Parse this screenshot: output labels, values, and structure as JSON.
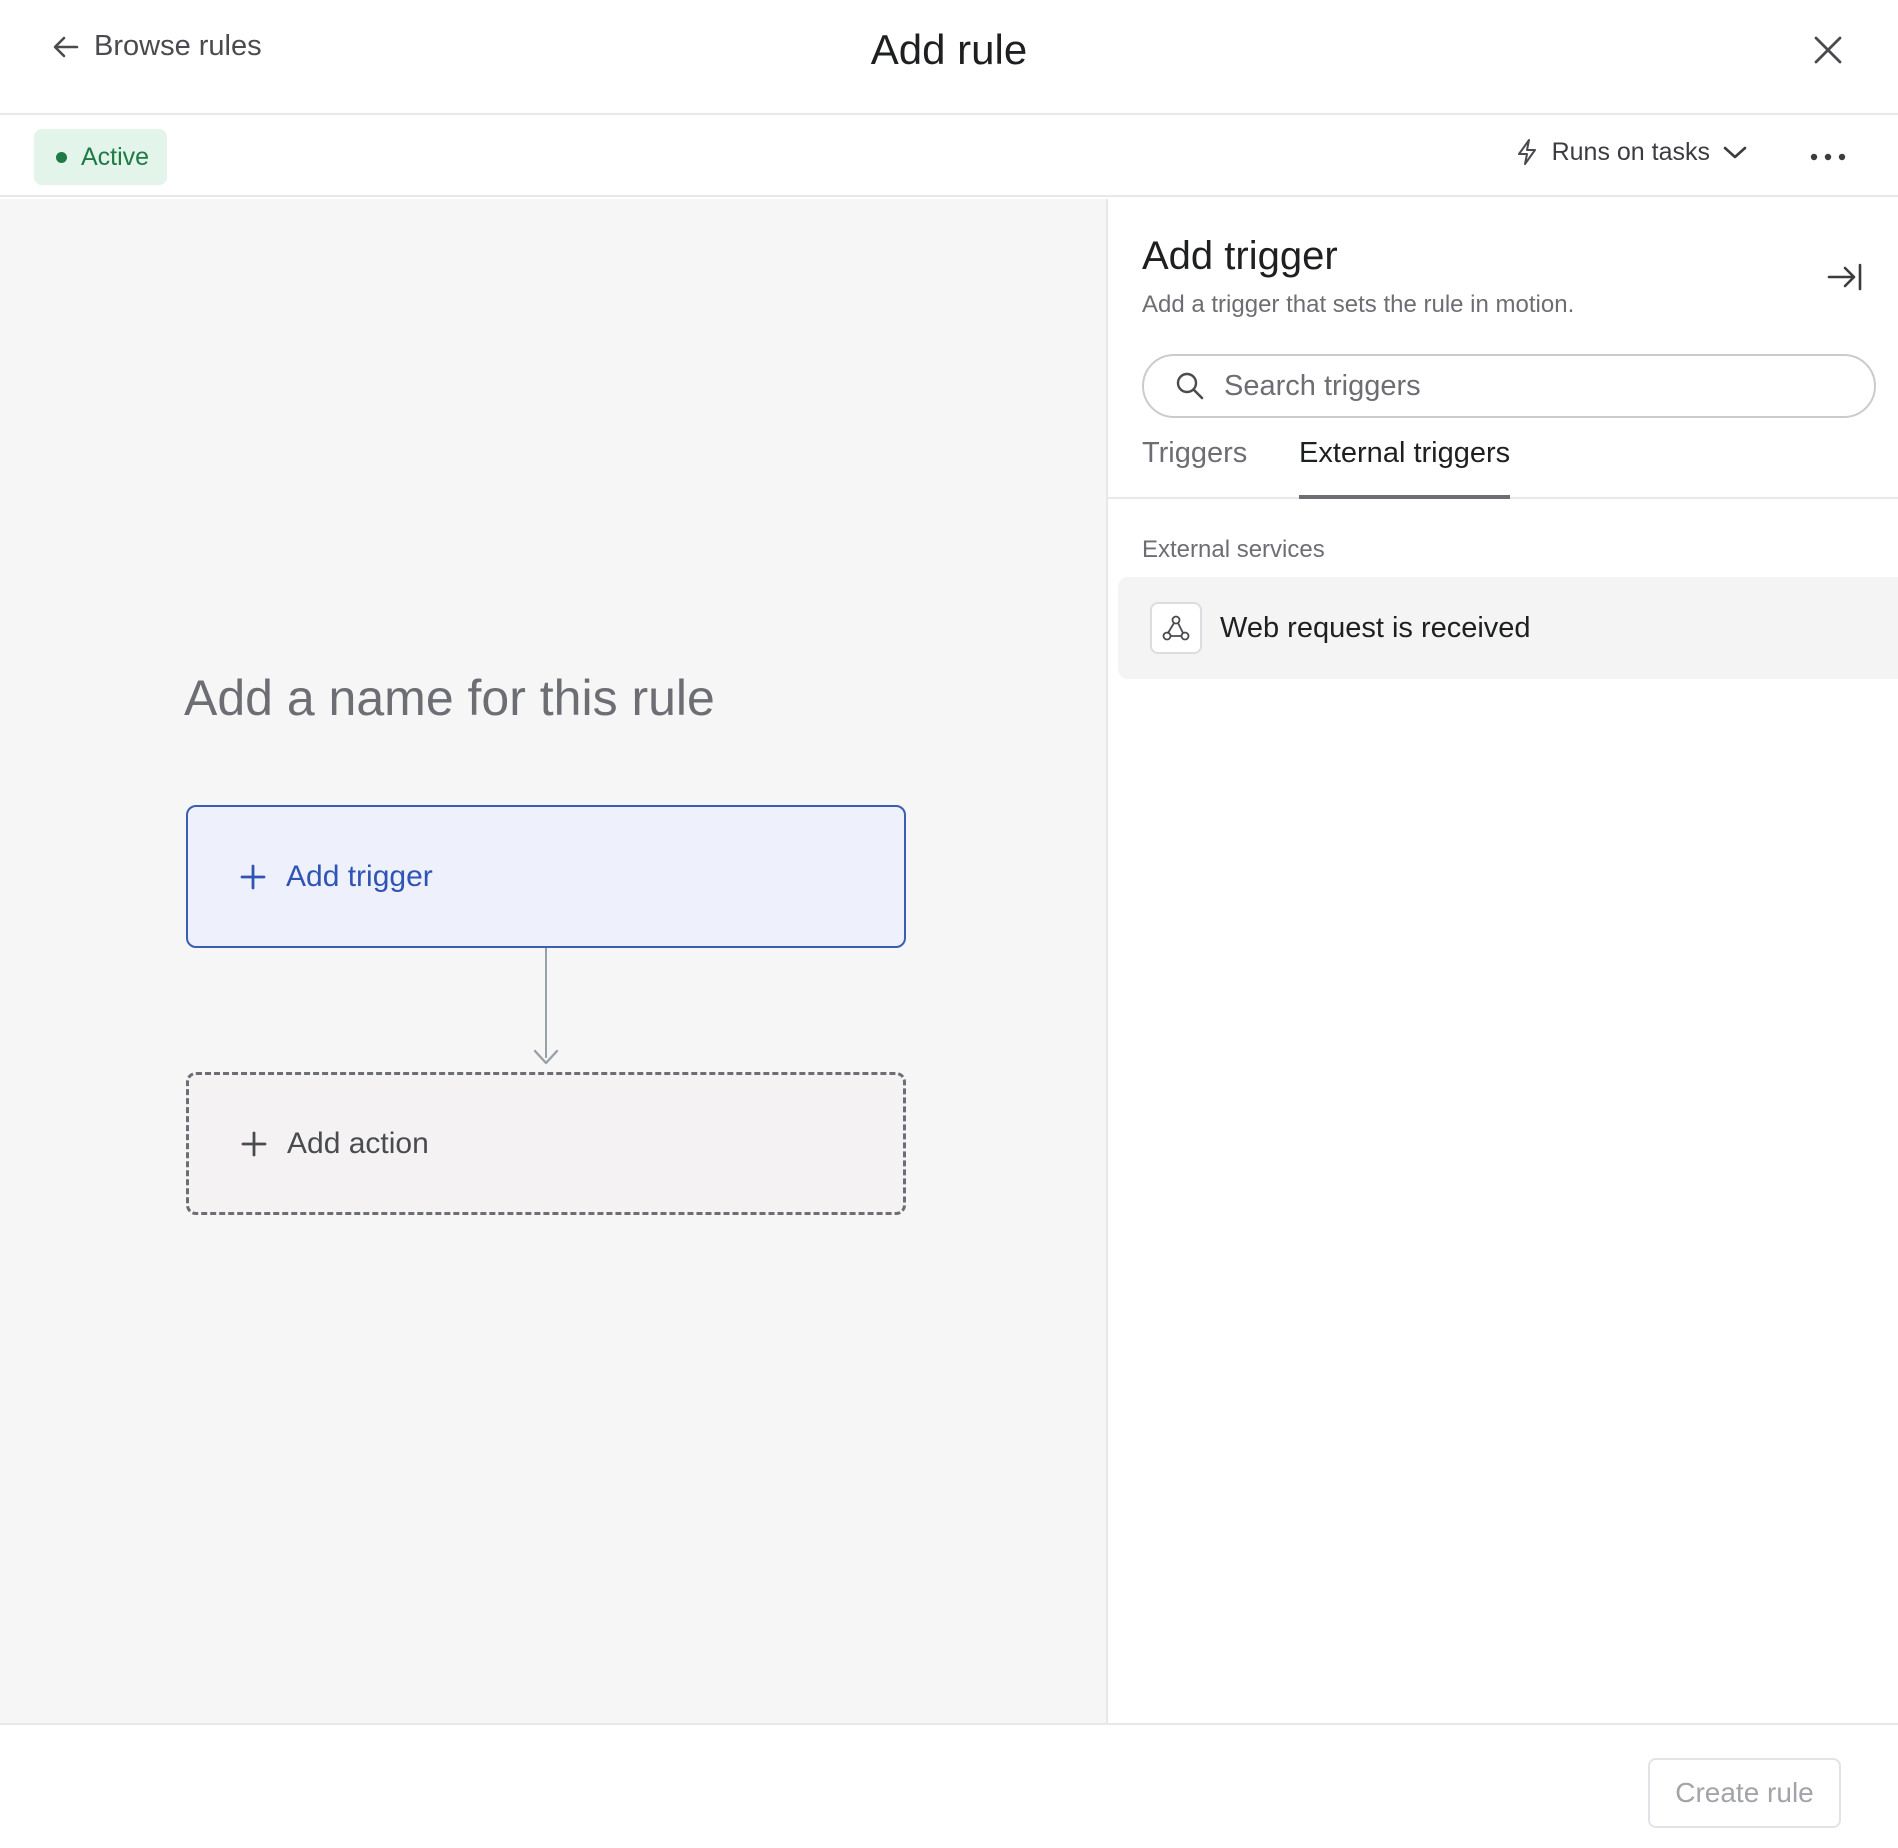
{
  "header": {
    "back_label": "Browse rules",
    "title": "Add rule"
  },
  "subheader": {
    "status": "Active",
    "runs_on": "Runs on tasks"
  },
  "canvas": {
    "rule_name_placeholder": "Add a name for this rule",
    "trigger_label": "Add trigger",
    "action_label": "Add action"
  },
  "panel": {
    "title": "Add trigger",
    "subtitle": "Add a trigger that sets the rule in motion.",
    "search_placeholder": "Search triggers",
    "tabs": [
      {
        "label": "Triggers",
        "active": false
      },
      {
        "label": "External triggers",
        "active": true
      }
    ],
    "section_label": "External services",
    "items": [
      {
        "label": "Web request is received",
        "icon": "webhook-icon"
      }
    ]
  },
  "footer": {
    "create_label": "Create rule"
  },
  "colors": {
    "accent": "#3d5db3",
    "active_green": "#1f7a46",
    "active_bg": "#e3f4ea"
  }
}
